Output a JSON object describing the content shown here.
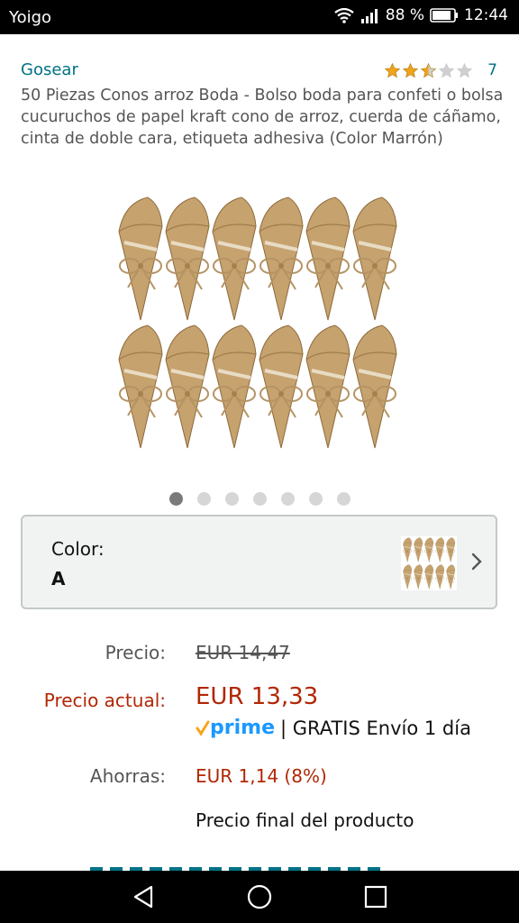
{
  "status": {
    "carrier": "Yoigo",
    "battery": "88 %",
    "time": "12:44"
  },
  "product": {
    "brand": "Gosear",
    "rating_value": 2.5,
    "rating_count": "7",
    "title": "50 Piezas Conos arroz Boda - Bolso boda para confeti o bolsa cucuruchos de papel kraft cono de arroz, cuerda de cáñamo, cinta de doble cara, etiqueta adhesiva (Color Marrón)"
  },
  "gallery": {
    "total_images": 7,
    "active_index": 0
  },
  "color_selector": {
    "label": "Color:",
    "value": "A"
  },
  "pricing": {
    "price_label": "Precio:",
    "price_old": "EUR 14,47",
    "current_label": "Precio actual:",
    "current_price": "EUR 13,33",
    "prime_text": "prime",
    "shipping": "| GRATIS Envío 1 día",
    "savings_label": "Ahorras:",
    "savings": "EUR 1,14 (8%)",
    "final_note": "Precio final del producto"
  },
  "colors": {
    "link": "#007185",
    "price_red": "#b12704",
    "star": "#f0a41c",
    "prime_blue": "#1a98ff",
    "prime_check": "#f7a51c"
  },
  "icons": {
    "wifi": "wifi-icon",
    "signal": "signal-icon",
    "battery": "battery-icon",
    "back": "back-triangle-icon",
    "home": "home-circle-icon",
    "recents": "recents-square-icon",
    "chevron": "chevron-right-icon"
  }
}
